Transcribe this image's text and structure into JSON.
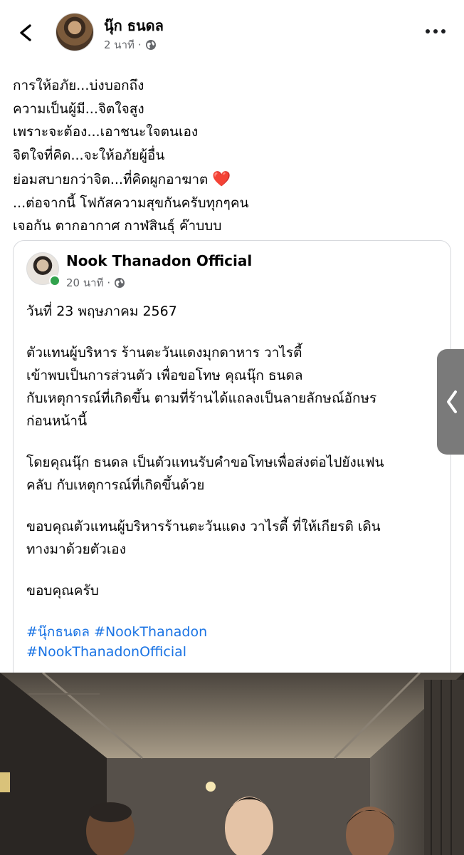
{
  "header": {
    "author_name": "นุ๊ก ธนดล",
    "time": "2 นาที",
    "separator": "·",
    "back_icon": "chevron-left",
    "privacy_icon": "globe-icon",
    "more_icon": "more-horizontal-icon"
  },
  "post": {
    "lines": [
      "การให้อภัย...บ่งบอกถึง",
      "ความเป็นผู้มี...จิตใจสูง",
      "เพราะจะต้อง...เอาชนะใจตนเอง",
      "จิตใจที่คิด...จะให้อภัยผู้อื่น",
      "ย่อมสบายกว่าจิต...ที่คิดผูกอาฆาต",
      "...ต่อจากนี้ โฟกัสความสุขกันครับทุกๆคน",
      "เจอกัน ตากอากาศ กาฬสินธุ์ ค๊าบบบ"
    ],
    "emoji": "❤️"
  },
  "shared": {
    "page_name": "Nook Thanadon Official",
    "time": "20 นาที",
    "separator": "·",
    "date_line": "วันที่ 23 พฤษภาคม 2567",
    "paragraph1": [
      "ตัวแทนผู้บริหาร ร้านตะวันแดงมุกดาหาร วาไรตี้",
      "เข้าพบเป็นการส่วนตัว เพื่อขอโทษ คุณนุ๊ก ธนดล",
      "กับเหตุการณ์ที่เกิดขึ้น ตามที่ร้านได้แถลงเป็นลายลักษณ์อักษร",
      "ก่อนหน้านี้"
    ],
    "paragraph2": [
      "โดยคุณนุ๊ก ธนดล เป็นตัวแทนรับคำขอโทษเพื่อส่งต่อไปยังแฟน",
      "คลับ กับเหตุการณ์ที่เกิดขึ้นด้วย"
    ],
    "paragraph3": [
      "ขอบคุณตัวแทนผู้บริหารร้านตะวันแดง วาไรตี้ ที่ให้เกียรติ เดิน",
      "ทางมาด้วยตัวเอง"
    ],
    "closing": "ขอบคุณครับ",
    "hashtags_line1": [
      "#นุ๊กธนดล",
      "#NookThanadon"
    ],
    "hashtags_line2": "#NookThanadonOfficial"
  },
  "colors": {
    "hashtag": "#1b74e4",
    "online_dot": "#31a24c",
    "meta_text": "#65676b",
    "side_handle": "#7a7a7a"
  }
}
